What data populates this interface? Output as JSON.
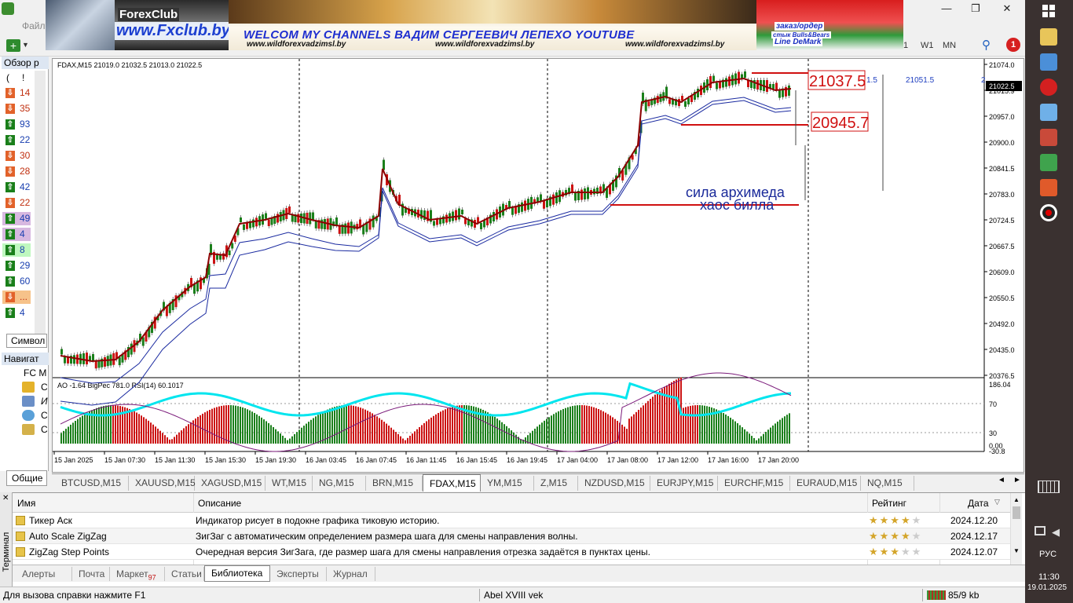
{
  "menu": {
    "file_label": "Файл"
  },
  "toolbar": {
    "timeframe_w1": "W1",
    "timeframe_mn": "MN",
    "timeframe_h4_partial": "1",
    "notification_count": "1"
  },
  "banner": {
    "logo": "ForexClub",
    "url": "www.Fxclub.by",
    "headline": "WELCOM MY CHANNELS ВАДИМ СЕРГЕЕВИЧ ЛЕПЕХО YOUTUBE",
    "site1": "www.wildforexvadzimsl.by",
    "site2": "www.wildforexvadzimsl.by",
    "site3": "www.wildforexvadzimsl.by",
    "right1": "заказ/ордер",
    "right2": "стык Bulls&Bears",
    "right3": "Line DeMark"
  },
  "market_watch": {
    "title": "Обзор р",
    "header_col1": "(",
    "header_col2": "!",
    "rows": [
      {
        "dir": "down",
        "value": "14"
      },
      {
        "dir": "down",
        "value": "35"
      },
      {
        "dir": "up",
        "value": "93"
      },
      {
        "dir": "up",
        "value": "22"
      },
      {
        "dir": "down",
        "value": "30"
      },
      {
        "dir": "down",
        "value": "28"
      },
      {
        "dir": "up",
        "value": "42"
      },
      {
        "dir": "down",
        "value": "22"
      },
      {
        "dir": "up",
        "value": "49"
      },
      {
        "dir": "up",
        "value": "4"
      },
      {
        "dir": "up",
        "value": "8"
      },
      {
        "dir": "up",
        "value": "29"
      },
      {
        "dir": "up",
        "value": "60"
      },
      {
        "dir": "down",
        "value": "..."
      },
      {
        "dir": "up",
        "value": "4"
      }
    ],
    "symbol_tab": "Символ"
  },
  "navigator": {
    "title": "Навигат",
    "root": "FC M",
    "items": [
      "С",
      "И",
      "С",
      "С"
    ],
    "tab": "Общие"
  },
  "chart": {
    "symbol_info": "FDAX,M15  21019.0 21032.5 21013.0 21022.5",
    "current_price": "21022.5",
    "price_axis": [
      "21074.0",
      "21015.9",
      "20957.0",
      "20900.0",
      "20841.5",
      "20783.0",
      "20724.5",
      "20667.5",
      "20609.0",
      "20550.5",
      "20492.0",
      "20435.0",
      "20376.5"
    ],
    "time_axis": [
      "15 Jan 2025",
      "15 Jan 07:30",
      "15 Jan 11:30",
      "15 Jan 15:30",
      "15 Jan 19:30",
      "16 Jan 03:45",
      "16 Jan 07:45",
      "16 Jan 11:45",
      "16 Jan 15:45",
      "16 Jan 19:45",
      "17 Jan 04:00",
      "17 Jan 08:00",
      "17 Jan 12:00",
      "17 Jan 16:00",
      "17 Jan 20:00"
    ],
    "label_high": "21037.5",
    "label_low": "20945.7",
    "label_small1": "1.5",
    "label_small2": "21051.5",
    "label_small3": "2",
    "caption1": "сила архимеда",
    "caption2": "хаос билла",
    "indicator_info": "AO -1.64  BigPec 781.0  RSI(14) 60.1017",
    "indicator_axis": [
      "186.04",
      "70",
      "30",
      "0.00",
      "-30.8"
    ],
    "color_up": "#1a7f1a",
    "color_down": "#cc1111",
    "color_rsi": "#00e5ee",
    "color_ma": "#8b0000"
  },
  "symbol_tabs": [
    "BTCUSD,M15",
    "XAUUSD,M15",
    "XAGUSD,M15",
    "WT,M15",
    "NG,M15",
    "BRN,M15",
    "FDAX,M15",
    "YM,M15",
    "Z,M15",
    "NZDUSD,M15",
    "EURJPY,M15",
    "EURCHF,M15",
    "EURAUD,M15",
    "NQ,M15"
  ],
  "active_symbol_tab": "FDAX,M15",
  "terminal": {
    "side_label": "Терминал",
    "col_name": "Имя",
    "col_desc": "Описание",
    "col_rating": "Рейтинг",
    "col_date": "Дата",
    "rows": [
      {
        "name": "Тикер Аск",
        "desc": "Индикатор рисует в подокне графика тиковую историю.",
        "stars": 4,
        "date": "2024.12.20"
      },
      {
        "name": "Auto Scale ZigZag",
        "desc": "ЗигЗаг с автоматическим определением размера шага для смены направления волны.",
        "stars": 4,
        "date": "2024.12.17"
      },
      {
        "name": "ZigZag Step Points",
        "desc": "Очередная версия ЗигЗага, где размер шага для смены направления отрезка задаётся в пунктах цены.",
        "stars": 3,
        "date": "2024.12.07"
      }
    ],
    "tabs": [
      {
        "label": "Алерты"
      },
      {
        "label": "Почта"
      },
      {
        "label": "Маркет",
        "badge": "97"
      },
      {
        "label": "Статьи"
      },
      {
        "label": "Библиотека",
        "active": true
      },
      {
        "label": "Эксперты"
      },
      {
        "label": "Журнал"
      }
    ]
  },
  "status": {
    "help": "Для вызова справки нажмите F1",
    "profile": "Abel XVIII vek",
    "traffic": "85/9 kb"
  },
  "taskbar": {
    "time": "11:30",
    "date": "19.01.2025",
    "lang": "РУС"
  }
}
